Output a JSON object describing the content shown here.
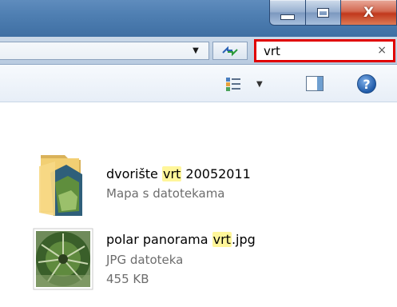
{
  "window": {
    "caption_buttons": {
      "minimize_icon": "minimize-icon",
      "maximize_icon": "maximize-icon",
      "close_icon": "close-icon",
      "close_glyph": "X"
    }
  },
  "address_bar": {
    "dropdown_icon": "chevron-down-icon",
    "dropdown_glyph": "▼",
    "refresh_icon": "refresh-arrows-icon"
  },
  "search": {
    "value": "vrt",
    "clear_glyph": "×",
    "border_color": "#e00000"
  },
  "toolbar": {
    "views_icon": "change-view-icon",
    "views_dropdown_glyph": "▼",
    "preview_pane_icon": "preview-pane-icon",
    "help_glyph": "?"
  },
  "results": [
    {
      "type": "folder",
      "icon": "folder-icon",
      "name_before": "dvorište ",
      "name_match": "vrt",
      "name_after": " 20052011",
      "kind": "Mapa s datotekama"
    },
    {
      "type": "file",
      "icon": "photo-thumbnail-icon",
      "name_before": "polar panorama ",
      "name_match": "vrt",
      "name_after": ".jpg",
      "kind": "JPG datoteka",
      "size": "455 KB"
    }
  ],
  "colors": {
    "highlight": "#fff69a",
    "title_glass": "#4f7fb2",
    "close_red": "#c1381c"
  }
}
